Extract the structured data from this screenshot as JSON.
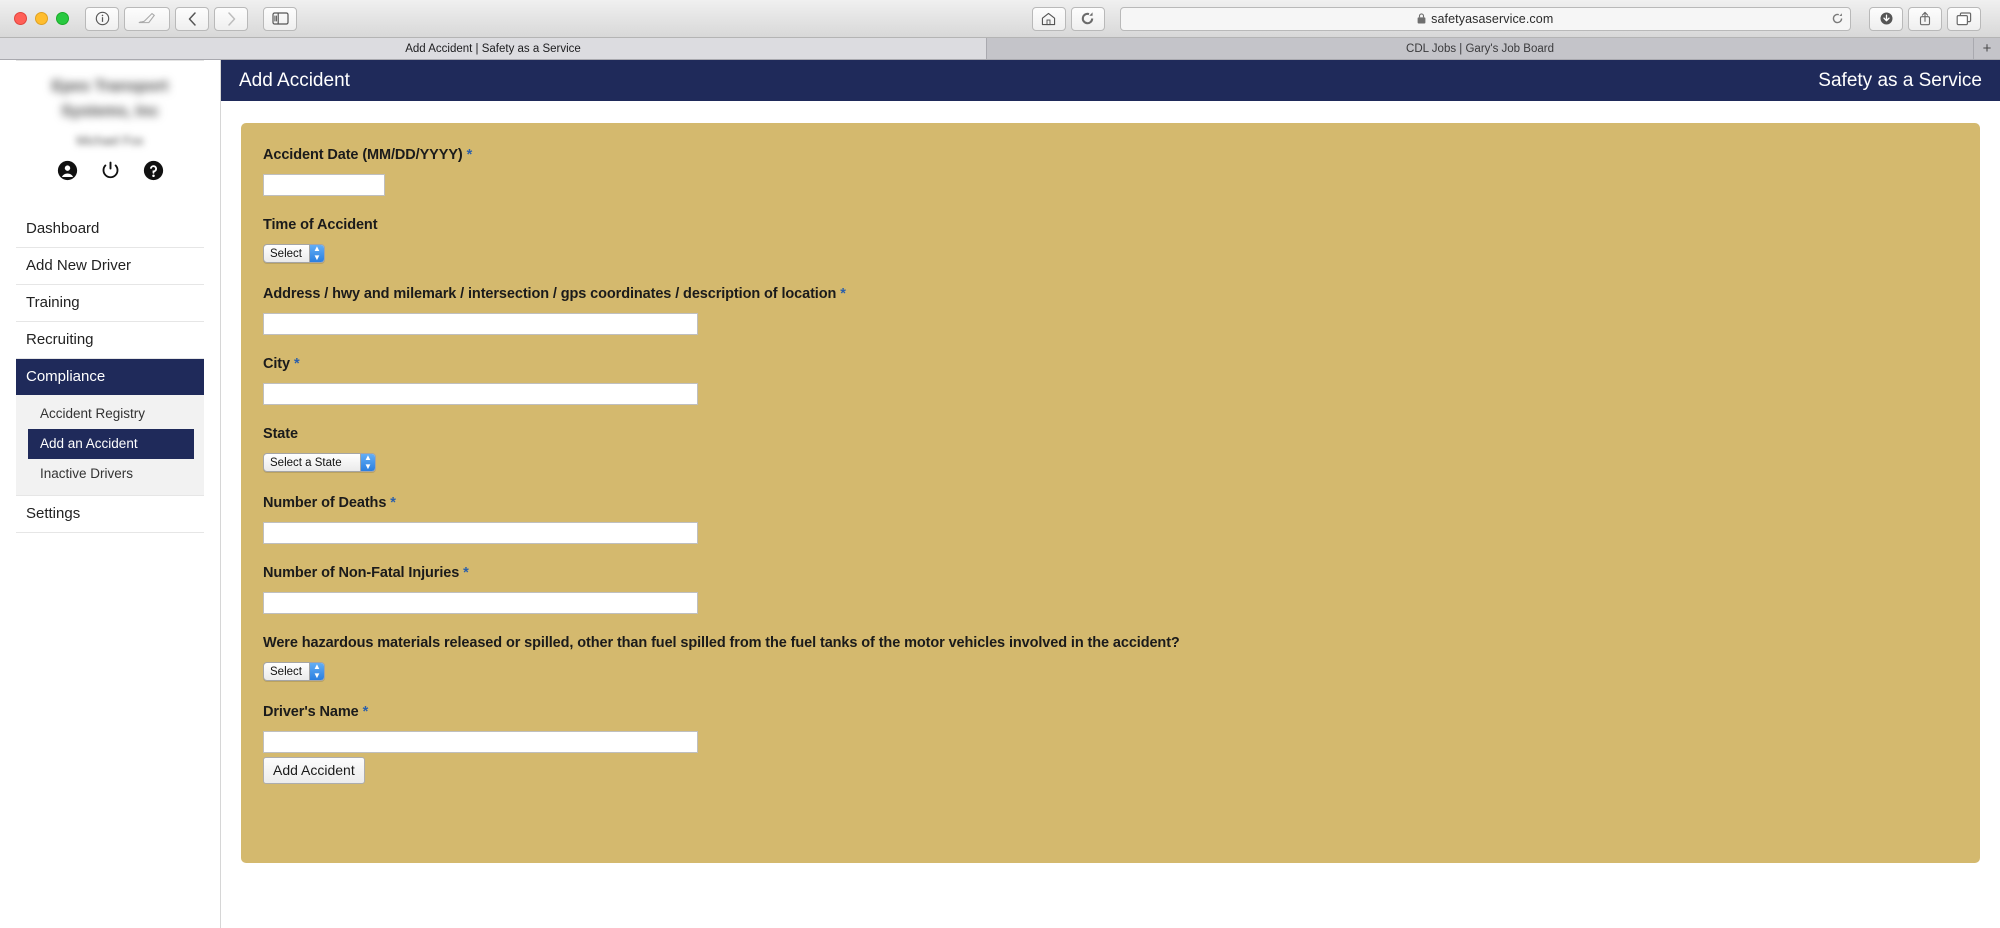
{
  "browser": {
    "url": "safetyasaservice.com",
    "lock_icon": "lock-icon",
    "buttons": {
      "info": "info-icon",
      "edit": "annotate-icon",
      "back": "back-chevron-icon",
      "forward": "forward-chevron-icon",
      "sidebar": "sidebar-toggle-icon",
      "home": "home-icon",
      "reload": "reload-icon",
      "downloads": "download-icon",
      "share": "share-icon",
      "tabs": "tab-overview-icon"
    },
    "tabs": [
      {
        "label": "Add Accident | Safety as a Service",
        "active": true
      },
      {
        "label": "CDL Jobs | Gary's Job Board",
        "active": false
      }
    ],
    "new_tab_label": "+"
  },
  "sidebar": {
    "company_line1": "Epes Transport",
    "company_line2": "Systems, Inc",
    "user_name": "Michael Fox",
    "account_icon": "account-circle-icon",
    "power_icon": "power-icon",
    "help_icon": "help-circle-icon",
    "items": [
      {
        "label": "Dashboard",
        "active": false
      },
      {
        "label": "Add New Driver",
        "active": false
      },
      {
        "label": "Training",
        "active": false
      },
      {
        "label": "Recruiting",
        "active": false
      },
      {
        "label": "Compliance",
        "active": true
      },
      {
        "label": "Settings",
        "active": false
      }
    ],
    "subitems": [
      {
        "label": "Accident Registry",
        "active": false
      },
      {
        "label": "Add an Accident",
        "active": true
      },
      {
        "label": "Inactive Drivers",
        "active": false
      }
    ]
  },
  "header": {
    "title": "Add Accident",
    "brand": "Safety as a Service",
    "bg_color": "#1f2a5a"
  },
  "form": {
    "card_color": "#d4b96e",
    "required_marker": "*",
    "fields": {
      "accident_date": {
        "label": "Accident Date (MM/DD/YYYY)",
        "required": true,
        "value": ""
      },
      "time_of_accident": {
        "label": "Time of Accident",
        "required": false,
        "selected": "Select"
      },
      "location": {
        "label": "Address / hwy and milemark / intersection / gps coordinates / description of location",
        "required": true,
        "value": ""
      },
      "city": {
        "label": "City",
        "required": true,
        "value": ""
      },
      "state": {
        "label": "State",
        "required": false,
        "selected": "Select a State"
      },
      "deaths": {
        "label": "Number of Deaths",
        "required": true,
        "value": ""
      },
      "injuries": {
        "label": "Number of Non-Fatal Injuries",
        "required": true,
        "value": ""
      },
      "hazmat": {
        "label": "Were hazardous materials released or spilled, other than fuel spilled from the fuel tanks of the motor vehicles involved in the accident?",
        "required": false,
        "selected": "Select"
      },
      "driver_name": {
        "label": "Driver's Name",
        "required": true,
        "value": ""
      }
    },
    "submit_label": "Add Accident"
  }
}
